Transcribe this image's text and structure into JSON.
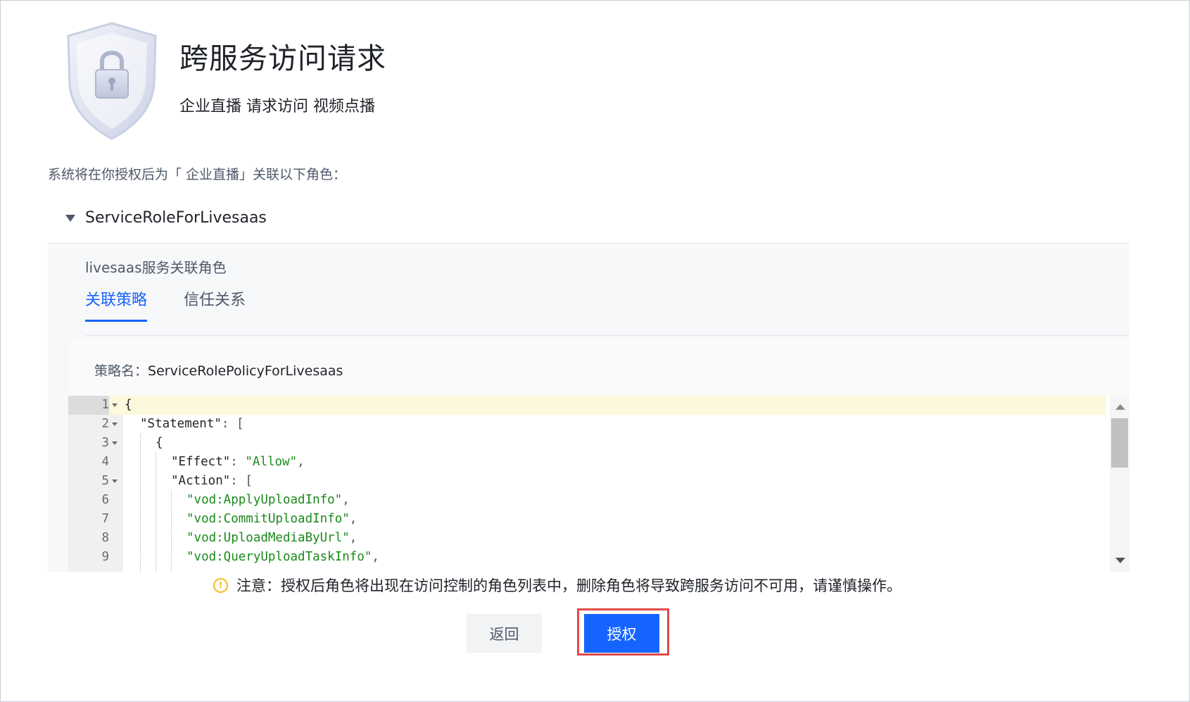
{
  "header": {
    "title": "跨服务访问请求",
    "subtitle": "企业直播 请求访问 视频点播"
  },
  "description": "系统将在你授权后为「 企业直播」关联以下角色：",
  "role": {
    "name": "ServiceRoleForLivesaas",
    "description": "livesaas服务关联角色",
    "tabs": [
      {
        "label": "关联策略",
        "active": true
      },
      {
        "label": "信任关系",
        "active": false
      }
    ],
    "policy_label": "策略名：",
    "policy_name": "ServiceRolePolicyForLivesaas",
    "code_lines": [
      {
        "n": "1",
        "fold": true
      },
      {
        "n": "2",
        "fold": true
      },
      {
        "n": "3",
        "fold": true
      },
      {
        "n": "4",
        "fold": false
      },
      {
        "n": "5",
        "fold": true
      },
      {
        "n": "6",
        "fold": false
      },
      {
        "n": "7",
        "fold": false
      },
      {
        "n": "8",
        "fold": false
      },
      {
        "n": "9",
        "fold": false
      }
    ],
    "code": {
      "l1": "{",
      "l2_key": "\"Statement\"",
      "l2_rest": ": [",
      "l3": "{",
      "l4_key": "\"Effect\"",
      "l4_val": "\"Allow\"",
      "l5_key": "\"Action\"",
      "l5_rest": ": [",
      "l6": "\"vod:ApplyUploadInfo\"",
      "l7": "\"vod:CommitUploadInfo\"",
      "l8": "\"vod:UploadMediaByUrl\"",
      "l9": "\"vod:QueryUploadTaskInfo\""
    }
  },
  "notice": "注意：授权后角色将出现在访问控制的角色列表中，删除角色将导致跨服务访问不可用，请谨慎操作。",
  "buttons": {
    "back": "返回",
    "authorize": "授权"
  },
  "colors": {
    "primary": "#1664ff",
    "warning": "#f7ba1e",
    "highlight_outline": "#e04a4a",
    "string": "#1a8a1a"
  }
}
